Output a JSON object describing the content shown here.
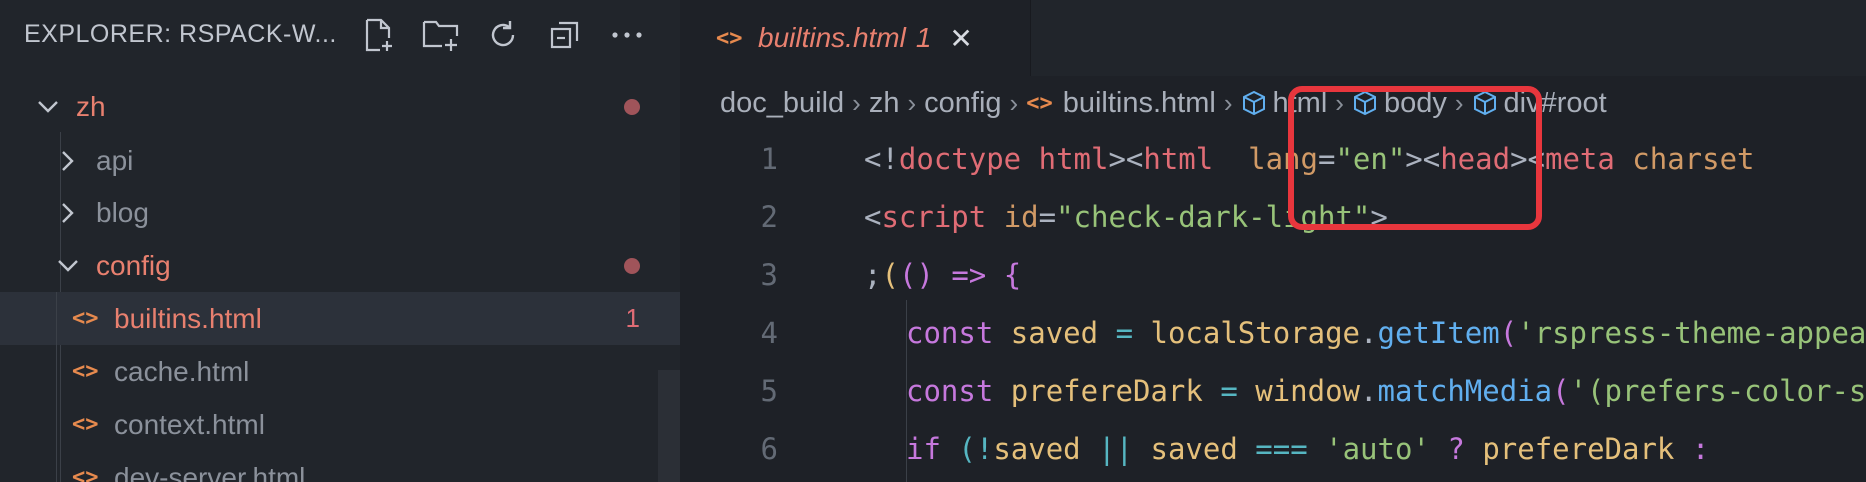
{
  "explorer": {
    "title": "EXPLORER: RSPACK-W...",
    "actions": [
      {
        "name": "new-file-icon"
      },
      {
        "name": "new-folder-icon"
      },
      {
        "name": "refresh-icon"
      },
      {
        "name": "collapse-all-icon"
      },
      {
        "name": "more-icon"
      }
    ],
    "tree": {
      "zh": {
        "label": "zh"
      },
      "api": {
        "label": "api"
      },
      "blog": {
        "label": "blog"
      },
      "config": {
        "label": "config"
      },
      "builtins": {
        "label": "builtins.html",
        "problems": "1"
      },
      "cache": {
        "label": "cache.html"
      },
      "context": {
        "label": "context.html"
      },
      "devserver": {
        "label": "dev-server.html"
      }
    }
  },
  "tab": {
    "label": "builtins.html",
    "problems": "1",
    "close_glyph": "✕"
  },
  "breadcrumb": {
    "items": [
      "doc_build",
      "zh",
      "config",
      "builtins.html",
      "html",
      "body",
      "div#root"
    ],
    "sep": "›"
  },
  "code": {
    "line_numbers": [
      "1",
      "2",
      "3",
      "4",
      "5",
      "6"
    ],
    "l1": {
      "t1": "<!",
      "t2": "doctype",
      "t3": " ",
      "t4": "html",
      "t5": "><",
      "t6": "html",
      "t7": "  ",
      "t8": "lang",
      "t9": "=",
      "t10": "\"en\"",
      "t11": "><",
      "t12": "head",
      "t13": "><",
      "t14": "meta",
      "t15": " ",
      "t16": "charset"
    },
    "l2": {
      "t1": "<",
      "t2": "script",
      "t3": " ",
      "t4": "id",
      "t5": "=",
      "t6": "\"check-dark-light\"",
      "t7": ">"
    },
    "l3": {
      "t1": ";",
      "t2": "(",
      "t3": "()",
      "t4": " ",
      "t5": "=>",
      "t6": " ",
      "t7": "{"
    },
    "l4": {
      "t1": "const",
      "t2": " ",
      "t3": "saved",
      "t4": " ",
      "t5": "=",
      "t6": " ",
      "t7": "localStorage",
      "t8": ".",
      "t9": "getItem",
      "t10": "(",
      "t11": "'rspress-theme-appearance'"
    },
    "l5": {
      "t1": "const",
      "t2": " ",
      "t3": "prefereDark",
      "t4": " ",
      "t5": "=",
      "t6": " ",
      "t7": "window",
      "t8": ".",
      "t9": "matchMedia",
      "t10": "(",
      "t11": "'(prefers-color-scheme: dark)'"
    },
    "l6": {
      "t1": "if",
      "t2": " ",
      "t3": "(",
      "t4": "!",
      "t5": "saved",
      "t6": " ",
      "t7": "||",
      "t8": " ",
      "t9": "saved",
      "t10": " ",
      "t11": "===",
      "t12": " ",
      "t13": "'auto'",
      "t14": " ",
      "t15": "?",
      "t16": " ",
      "t17": "prefereDark",
      "t18": " ",
      "t19": ":"
    }
  },
  "colors": {
    "highlight": "#e8363d",
    "accent": "#e8806f"
  }
}
